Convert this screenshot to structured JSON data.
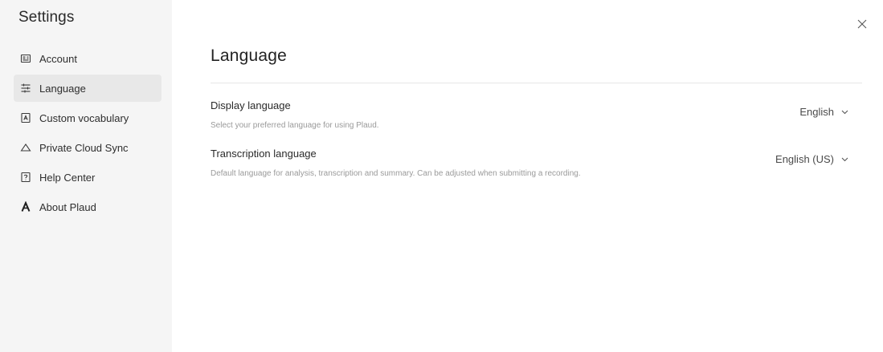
{
  "sidebar": {
    "title": "Settings",
    "items": [
      {
        "label": "Account",
        "icon": "id-card-icon"
      },
      {
        "label": "Language",
        "icon": "sliders-icon",
        "active": true
      },
      {
        "label": "Custom vocabulary",
        "icon": "vocabulary-book-icon"
      },
      {
        "label": "Private Cloud Sync",
        "icon": "cloud-icon"
      },
      {
        "label": "Help Center",
        "icon": "help-question-icon"
      },
      {
        "label": "About Plaud",
        "icon": "plaud-logo-icon"
      }
    ]
  },
  "main": {
    "title": "Language",
    "settings": [
      {
        "name": "Display language",
        "description": "Select your preferred language for using Plaud.",
        "value": "English"
      },
      {
        "name": "Transcription language",
        "description": "Default language for analysis, transcription and summary. Can be adjusted when submitting a recording.",
        "value": "English (US)"
      }
    ]
  },
  "window": {
    "close_icon": "close-icon"
  },
  "colors": {
    "sidebar_bg": "#f5f5f5",
    "active_item_bg": "#e8e8e8",
    "divider": "#e6e6e6",
    "muted_text": "#9a9a9a"
  }
}
